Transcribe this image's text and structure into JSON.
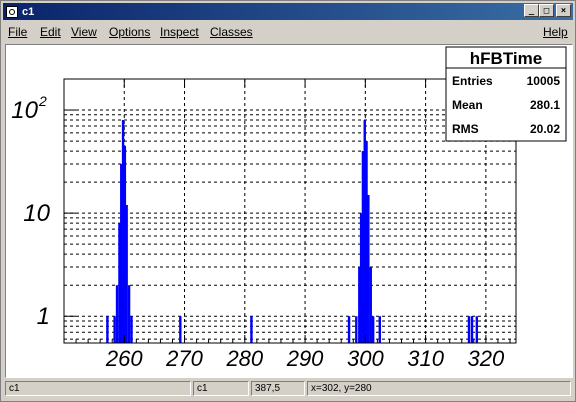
{
  "window": {
    "title": "c1"
  },
  "titlebar_buttons": [
    "_",
    "□",
    "×"
  ],
  "menu": {
    "file": "File",
    "edit": "Edit",
    "view": "View",
    "options": "Options",
    "inspect": "Inspect",
    "classes": "Classes",
    "help": "Help"
  },
  "stats": {
    "title": "hFBTime",
    "entries_label": "Entries",
    "entries_value": "10005",
    "mean_label": "Mean",
    "mean_value": "280.1",
    "rms_label": "RMS",
    "rms_value": "20.02"
  },
  "status": {
    "field1": "c1",
    "field2": "c1",
    "field3": "387,5",
    "field4": "x=302, y=280"
  },
  "chart_data": {
    "type": "bar",
    "log_scale_y": true,
    "grid": true,
    "xlim": [
      250,
      325
    ],
    "ylim": [
      0.55,
      200
    ],
    "x_ticks": [
      260,
      270,
      280,
      290,
      300,
      310,
      320
    ],
    "x_tick_labels": [
      "260",
      "270",
      "280",
      "290",
      "300",
      "310",
      "320"
    ],
    "y_ticks": [
      1,
      10,
      100
    ],
    "y_tick_labels": [
      "1",
      "10",
      "10"
    ],
    "y_tick_exponent": "2",
    "bar_color": "#0000ff",
    "bins": [
      {
        "x": 257.2,
        "y": 1
      },
      {
        "x": 258.4,
        "y": 1
      },
      {
        "x": 258.8,
        "y": 2
      },
      {
        "x": 259.2,
        "y": 8
      },
      {
        "x": 259.5,
        "y": 30
      },
      {
        "x": 259.8,
        "y": 80
      },
      {
        "x": 260.1,
        "y": 45
      },
      {
        "x": 260.4,
        "y": 12
      },
      {
        "x": 260.8,
        "y": 2
      },
      {
        "x": 261.2,
        "y": 1
      },
      {
        "x": 269.3,
        "y": 1
      },
      {
        "x": 281.1,
        "y": 1
      },
      {
        "x": 297.3,
        "y": 1
      },
      {
        "x": 298.5,
        "y": 1
      },
      {
        "x": 299.0,
        "y": 3
      },
      {
        "x": 299.3,
        "y": 10
      },
      {
        "x": 299.6,
        "y": 40
      },
      {
        "x": 299.9,
        "y": 80
      },
      {
        "x": 300.2,
        "y": 50
      },
      {
        "x": 300.5,
        "y": 15
      },
      {
        "x": 300.9,
        "y": 3
      },
      {
        "x": 301.3,
        "y": 1
      },
      {
        "x": 302.4,
        "y": 1
      },
      {
        "x": 317.2,
        "y": 1
      },
      {
        "x": 317.7,
        "y": 1
      },
      {
        "x": 318.5,
        "y": 1
      }
    ]
  }
}
